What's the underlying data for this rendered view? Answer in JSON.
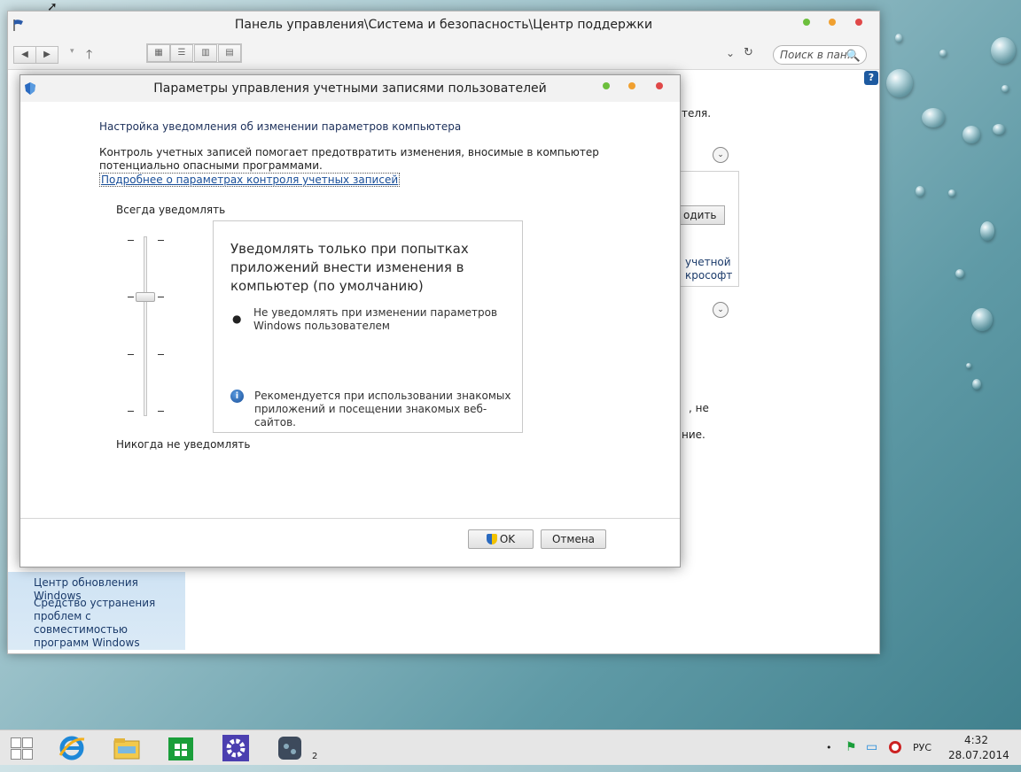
{
  "colors": {
    "accent": "#1a4f99",
    "dot_green": "#6cbf3c",
    "dot_orange": "#f0a030",
    "dot_red": "#e04848"
  },
  "control_panel": {
    "title": "Панель управления\\Система и безопасность\\Центр поддержки",
    "icon": "flag-icon",
    "nav": {
      "back_icon": "◀",
      "forward_icon": "▶",
      "up_icon": "🡑",
      "dropdown_icon": "⌄",
      "refresh_icon": "↻"
    },
    "search": {
      "placeholder": "Поиск в пан...",
      "icon": "🔍"
    },
    "help_icon": "?",
    "sidebar": {
      "items": [
        {
          "label": "Центр обновления Windows"
        },
        {
          "label": "Средство устранения проблем с совместимостью программ Windows"
        }
      ]
    },
    "background_fragments": {
      "t1": "теля.",
      "btn": "одить",
      "t2": "учетной",
      "t3": "крософт",
      "t4": ", не",
      "t5": "ние."
    }
  },
  "uac_dialog": {
    "title": "Параметры управления учетными записями пользователей",
    "heading": "Настройка уведомления об изменении параметров компьютера",
    "description": "Контроль учетных записей помогает предотвратить изменения, вносимые в компьютер потенциально опасными программами.",
    "link": "Подробнее о параметрах контроля учетных записей",
    "slider": {
      "top_label": "Всегда уведомлять",
      "bottom_label": "Никогда не уведомлять",
      "levels": 4,
      "selected_level": 3
    },
    "info": {
      "title": "Уведомлять только при попытках приложений внести изменения в компьютер (по умолчанию)",
      "bullet": "Не уведомлять при изменении параметров Windows пользователем",
      "note": "Рекомендуется при использовании знакомых приложений и посещении знакомых веб-сайтов."
    },
    "ok_label": "OK",
    "cancel_label": "Отмена"
  },
  "taskbar": {
    "items": [
      {
        "name": "start",
        "icon": "windows-logo-icon"
      },
      {
        "name": "internet-explorer",
        "icon": "ie-icon"
      },
      {
        "name": "file-explorer",
        "icon": "folder-icon"
      },
      {
        "name": "store",
        "icon": "store-icon"
      },
      {
        "name": "settings",
        "icon": "gear-icon"
      },
      {
        "name": "app",
        "icon": "app-icon",
        "badge": "2"
      }
    ],
    "tray": {
      "language": "РУС",
      "time": "4:32",
      "date": "28.07.2014"
    }
  }
}
